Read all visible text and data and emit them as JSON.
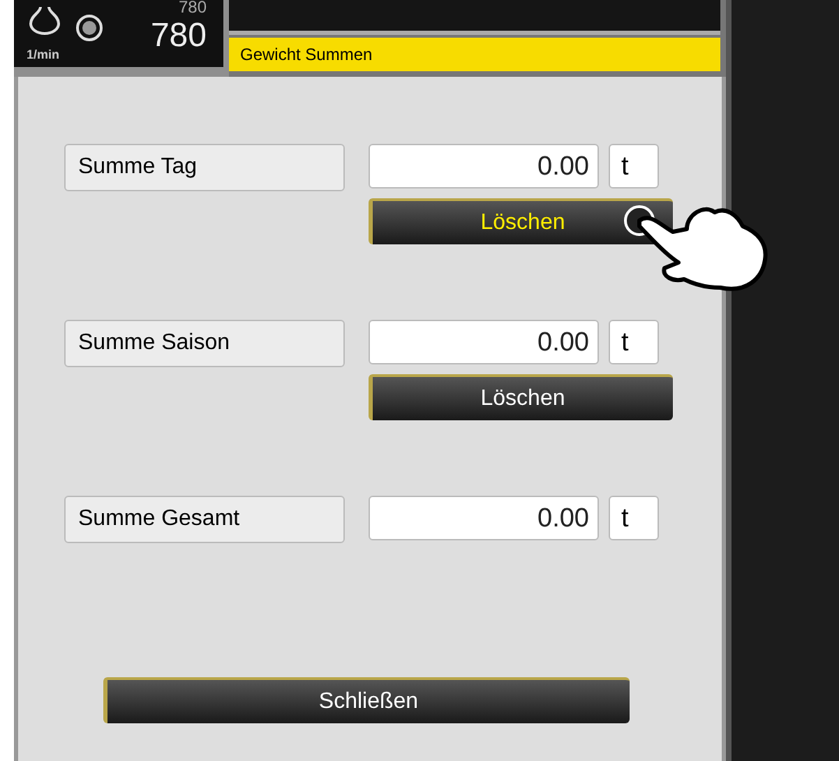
{
  "header": {
    "speed_previous": "780",
    "speed": "780",
    "speed_unit": "1/min",
    "title": "Gewicht Summen"
  },
  "totals": [
    {
      "label": "Summe Tag",
      "value": "0.00",
      "unit": "t",
      "button": {
        "label": "Löschen",
        "pressed": true
      }
    },
    {
      "label": "Summe Saison",
      "value": "0.00",
      "unit": "t",
      "button": {
        "label": "Löschen",
        "pressed": false
      }
    },
    {
      "label": "Summe Gesamt",
      "value": "0.00",
      "unit": "t"
    }
  ],
  "close_button": "Schließen"
}
